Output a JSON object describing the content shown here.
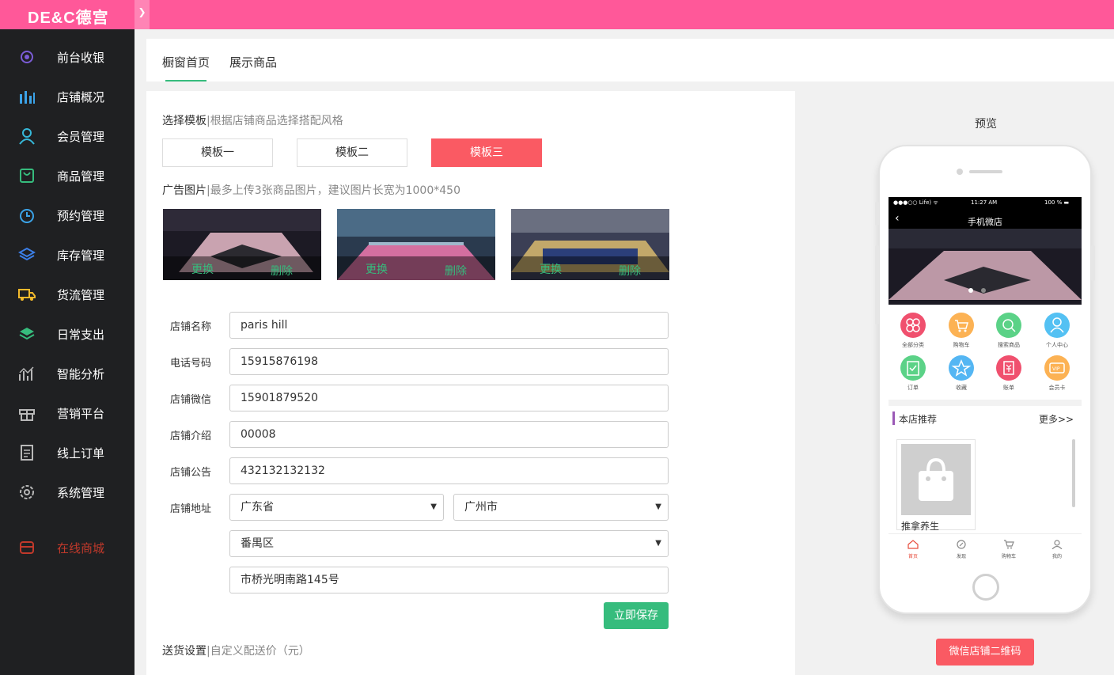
{
  "app": {
    "logo": "DE&C德宫",
    "collapse_glyph": "❯"
  },
  "sidebar": {
    "items": [
      {
        "label": "前台收银",
        "icon": "cashier-icon",
        "color": "#7b5cd6"
      },
      {
        "label": "店铺概况",
        "icon": "bar-chart-icon",
        "color": "#3ba3e8"
      },
      {
        "label": "会员管理",
        "icon": "user-icon",
        "color": "#36b8d9"
      },
      {
        "label": "商品管理",
        "icon": "shopping-bag-icon",
        "color": "#36bc7d"
      },
      {
        "label": "预约管理",
        "icon": "alarm-clock-icon",
        "color": "#3ba3e8"
      },
      {
        "label": "库存管理",
        "icon": "layers-icon",
        "color": "#3b7fe8"
      },
      {
        "label": "货流管理",
        "icon": "truck-icon",
        "color": "#f2b92c"
      },
      {
        "label": "日常支出",
        "icon": "stack-icon",
        "color": "#36bc7d"
      },
      {
        "label": "智能分析",
        "icon": "analytics-icon",
        "color": "#b8b8b8"
      },
      {
        "label": "营销平台",
        "icon": "gift-icon",
        "color": "#b8b8b8"
      },
      {
        "label": "线上订单",
        "icon": "order-list-icon",
        "color": "#b8b8b8"
      },
      {
        "label": "系统管理",
        "icon": "gear-icon",
        "color": "#b8b8b8"
      },
      {
        "label": "在线商城",
        "icon": "store-icon",
        "color": "#c0392b"
      }
    ]
  },
  "tabs": [
    {
      "label": "橱窗首页",
      "active": true
    },
    {
      "label": "展示商品",
      "active": false
    }
  ],
  "template_section": {
    "title": "选择模板",
    "hint": "|根据店铺商品选择搭配风格",
    "options": [
      "模板一",
      "模板二",
      "模板三"
    ],
    "selected": "模板三"
  },
  "ad_section": {
    "title": "广告图片",
    "hint": "|最多上传3张商品图片，建议图片长宽为1000*450",
    "change_label": "更换",
    "delete_label": "删除"
  },
  "form": {
    "name_label": "店铺名称",
    "name_value": "paris hill",
    "phone_label": "电话号码",
    "phone_value": "15915876198",
    "wechat_label": "店铺微信",
    "wechat_value": "15901879520",
    "intro_label": "店铺介绍",
    "intro_value": "00008",
    "notice_label": "店铺公告",
    "notice_value": "432132132132",
    "address_label": "店铺地址",
    "province": "广东省",
    "city": "广州市",
    "district": "番禺区",
    "street": "市桥光明南路145号",
    "save_label": "立即保存"
  },
  "delivery_section": {
    "title": "送货设置",
    "hint": "|自定义配送价（元）"
  },
  "preview": {
    "title": "预览",
    "status_left": "●●●○○ Life) ᯤ",
    "status_time": "11:27 AM",
    "status_right": "100 % ▬",
    "header_title": "手机微店",
    "categories": [
      {
        "label": "全部分类",
        "icon": "all-categories-icon",
        "color": "#f0506e"
      },
      {
        "label": "购物车",
        "icon": "cart-icon",
        "color": "#fcb254"
      },
      {
        "label": "搜索商品",
        "icon": "search-icon",
        "color": "#5bd287"
      },
      {
        "label": "个人中心",
        "icon": "user-icon",
        "color": "#54c1f3"
      },
      {
        "label": "订单",
        "icon": "order-icon",
        "color": "#5bd287"
      },
      {
        "label": "收藏",
        "icon": "star-icon",
        "color": "#54b6f3"
      },
      {
        "label": "账单",
        "icon": "bill-icon",
        "color": "#f0506e"
      },
      {
        "label": "会员卡",
        "icon": "vip-card-icon",
        "color": "#fcb254"
      }
    ],
    "recommend_title": "本店推荐",
    "more_label": "更多>>",
    "product_name": "推拿养生",
    "bottom_nav": [
      {
        "label": "首页",
        "icon": "home-icon",
        "active": true
      },
      {
        "label": "发现",
        "icon": "compass-icon",
        "active": false
      },
      {
        "label": "购物车",
        "icon": "cart-icon",
        "active": false
      },
      {
        "label": "我的",
        "icon": "user-icon",
        "active": false
      }
    ],
    "qr_label": "微信店铺二维码"
  },
  "colors": {
    "topbar": "#ff5899",
    "sidebar": "#1f2022",
    "accent_green": "#36bc7d",
    "accent_red": "#fa5a63"
  }
}
